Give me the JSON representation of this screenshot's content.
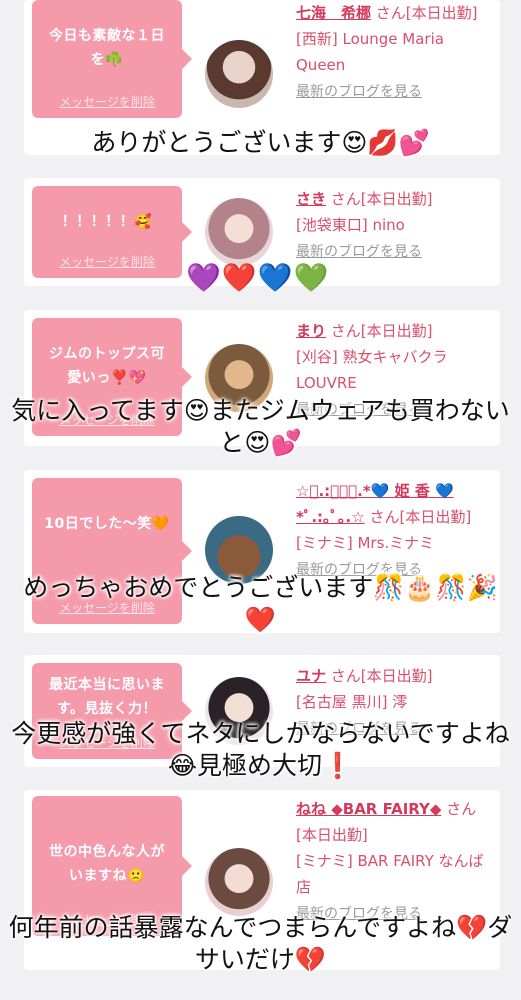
{
  "messages": [
    {
      "bubble": "今日も素敵な１日を☘️",
      "delete": "メッセージを削除",
      "name": "七海　希梛",
      "san": "さん[本日出勤]",
      "store": "[西新] Lounge Maria Queen",
      "blog": "最新のブログを見る",
      "overlay": "ありがとうございます😍💋💕"
    },
    {
      "bubble": "！！！！！🥰",
      "delete": "メッセージを削除",
      "name": "さき",
      "san": "さん[本日出勤]",
      "store": "[池袋東口] nino",
      "blog": "最新のブログを見る",
      "overlay": "💜❤️💙💚"
    },
    {
      "bubble": "ジムのトップス可愛いっ❣️💖",
      "delete": "メッセージを削除",
      "name": "まり",
      "san": "さん[本日出勤]",
      "store": "[刈谷] 熟女キャバクラ LOUVRE",
      "blog": "最新のブログを見る",
      "overlay": "気に入ってます😍またジムウェアも買わないと😍💕"
    },
    {
      "bubble": "10日でした〜笑🧡",
      "delete": "メッセージを削除",
      "name": "☆ﾟ.:｡ﾟ｡.*💙 姫 香 💙*ﾟ.:｡ﾟ｡.☆",
      "san": "さん[本日出勤]",
      "store": "[ミナミ] Mrs.ミナミ",
      "blog": "最新のブログを見る",
      "overlay": "めっちゃおめでとうございます🎊🎂🎊🎉❤️"
    },
    {
      "bubble": "最近本当に思います。見抜く力！",
      "delete": "メッセージを削除",
      "name": "ユナ",
      "san": "さん[本日出勤]",
      "store": "[名古屋 黒川] 澪",
      "blog": "最新のブログを見る",
      "overlay": "今更感が強くてネタにしかならないですよね😂見極め大切❗️"
    },
    {
      "bubble": "世の中色んな人がいますね🙁",
      "delete": "メッセージを削除",
      "name": "ねね ◆BAR FAIRY◆",
      "san": "さん[本日出勤]",
      "store": "[ミナミ] BAR FAIRY なんば店",
      "blog": "最新のブログを見る",
      "overlay": "何年前の話暴露なんでつまらんですよね💔ダサいだけ💔"
    }
  ]
}
